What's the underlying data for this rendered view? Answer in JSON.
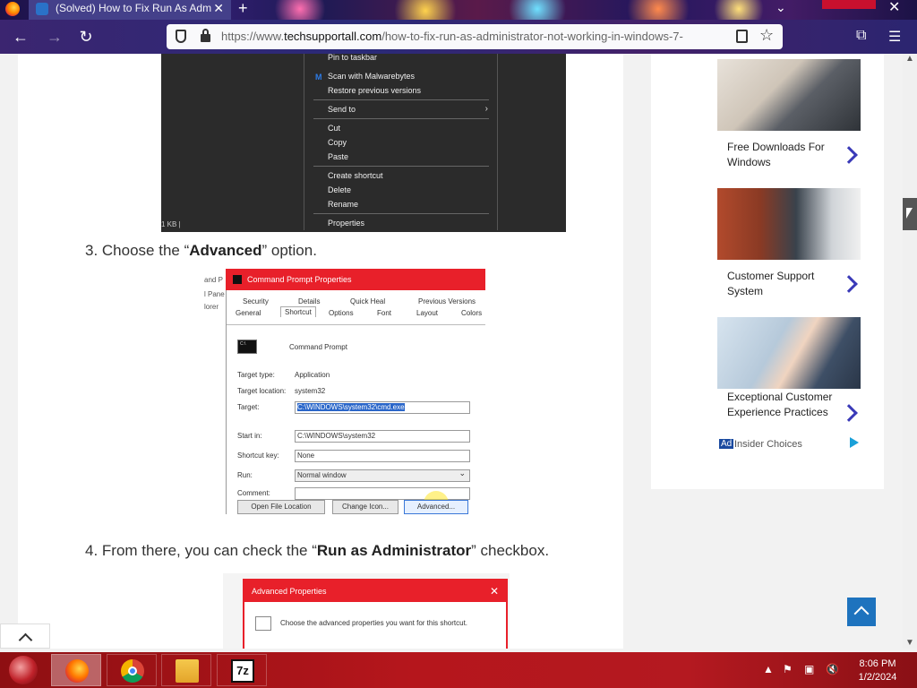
{
  "browser": {
    "tab_title": "(Solved) How to Fix Run As Adm",
    "url_prefix": "https://www.",
    "url_domain": "techsupportall.com",
    "url_path": "/how-to-fix-run-as-administrator-not-working-in-windows-7-",
    "new_tab_symbol": "+",
    "tab_close_symbol": "✕"
  },
  "context_menu": {
    "items": [
      "Pin to taskbar",
      "Scan with Malwarebytes",
      "Restore previous versions",
      "Send to",
      "Cut",
      "Copy",
      "Paste",
      "Create shortcut",
      "Delete",
      "Rename",
      "Properties"
    ],
    "status": "1 KB  |"
  },
  "steps": {
    "step3_prefix": "3. Choose the “",
    "step3_bold": "Advanced",
    "step3_suffix": "” option.",
    "step4_prefix": "4. From there, you can check the “",
    "step4_bold": "Run as Administrator",
    "step4_suffix": "” checkbox."
  },
  "properties_dialog": {
    "side_labels": [
      "and P",
      "l Pane",
      "lorer"
    ],
    "title": "Command Prompt Properties",
    "tabs_row1": [
      "Security",
      "Details",
      "Quick Heal",
      "Previous Versions"
    ],
    "tabs_row2": [
      "General",
      "Shortcut",
      "Options",
      "Font",
      "Layout",
      "Colors"
    ],
    "name": "Command Prompt",
    "target_type_label": "Target type:",
    "target_type_value": "Application",
    "target_location_label": "Target location:",
    "target_location_value": "system32",
    "target_label": "Target:",
    "target_value": "C:\\WINDOWS\\system32\\cmd.exe",
    "start_in_label": "Start in:",
    "start_in_value": "C:\\WINDOWS\\system32",
    "shortcut_key_label": "Shortcut key:",
    "shortcut_key_value": "None",
    "run_label": "Run:",
    "run_value": "Normal window",
    "comment_label": "Comment:",
    "buttons": [
      "Open File Location",
      "Change Icon...",
      "Advanced..."
    ]
  },
  "advanced_dialog": {
    "title": "Advanced Properties",
    "close": "✕",
    "description": "Choose the advanced properties you want for this shortcut."
  },
  "sidebar_ads": {
    "items": [
      {
        "title": "Free Downloads For Windows"
      },
      {
        "title": "Customer Support System"
      },
      {
        "title": "Exceptional Customer Experience Practices"
      }
    ],
    "badge": "Ad",
    "source": "Insider Choices"
  },
  "taskbar": {
    "apps": [
      "firefox",
      "chrome",
      "file-explorer",
      "7zip"
    ],
    "sevenzip_label": "7z",
    "time": "8:06 PM",
    "date": "1/2/2024"
  },
  "colors": {
    "accent_red": "#e8202a",
    "scroll_top_blue": "#1e73be",
    "taskbar_red": "#b5161c"
  }
}
